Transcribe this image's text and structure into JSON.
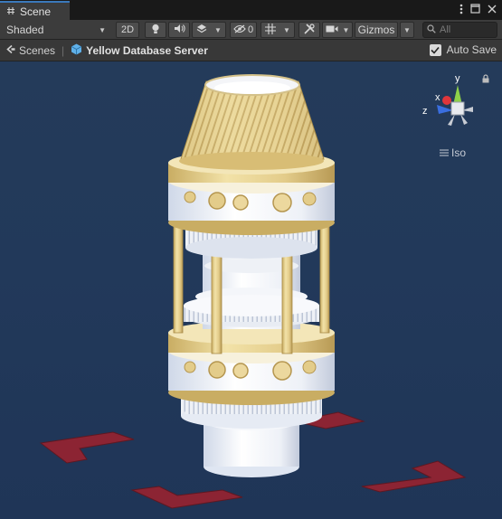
{
  "tab": {
    "title": "Scene",
    "icon": "hash-icon"
  },
  "window_controls": [
    "more-vert-icon",
    "maximize-icon",
    "close-icon"
  ],
  "toolbar": {
    "shading_mode": "Shaded",
    "mode_2d": "2D",
    "hidden_count": "0",
    "gizmos_label": "Gizmos",
    "search_placeholder": "All"
  },
  "breadcrumb": {
    "scenes_label": "Scenes",
    "object_label": "Yellow Database Server"
  },
  "autosave": {
    "label": "Auto Save",
    "checked": true
  },
  "orientation_gizmo": {
    "axes": {
      "x": "x",
      "y": "y",
      "z": "z"
    },
    "projection_label": "Iso",
    "colors": {
      "x": "#e0363b",
      "y": "#8ed049",
      "z": "#3a6ee0"
    }
  },
  "colors": {
    "accent_tab": "#3a79bb",
    "toolbar_bg": "#3c3c3c",
    "viewport_bg": "#22395a",
    "model_gold": "#e3cc8a",
    "model_white": "#f2f4f8",
    "floor_marker": "#8c2433"
  }
}
